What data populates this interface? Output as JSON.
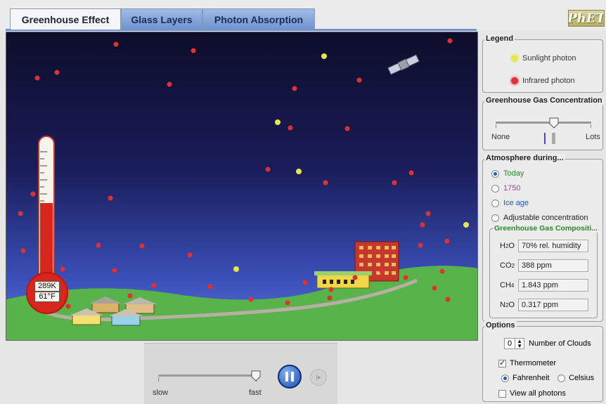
{
  "tabs": [
    {
      "label": "Greenhouse Effect",
      "active": true
    },
    {
      "label": "Glass Layers",
      "active": false
    },
    {
      "label": "Photon Absorption",
      "active": false
    }
  ],
  "logo": {
    "text": "PhET"
  },
  "thermometer": {
    "kelvin": "289K",
    "fahrenheit": "61°F"
  },
  "sim_controls": {
    "slow_label": "slow",
    "fast_label": "fast",
    "speed_fraction": 0.95,
    "pause_icon": "pause-icon",
    "step_icon": "step-icon"
  },
  "legend": {
    "title": "Legend",
    "sunlight_label": "Sunlight photon",
    "infrared_label": "Infrared photon",
    "sunlight_color": "#e6e84a",
    "infrared_color": "#e23030"
  },
  "concentration": {
    "title": "Greenhouse Gas Concentration",
    "none_label": "None",
    "lots_label": "Lots",
    "level_fraction": 0.7
  },
  "atmosphere": {
    "title": "Atmosphere during...",
    "options": [
      {
        "label": "Today",
        "selected": true,
        "color": "#2a8a2a"
      },
      {
        "label": "1750",
        "selected": false,
        "color": "#a040c0"
      },
      {
        "label": "Ice age",
        "selected": false,
        "color": "#1e5ac8"
      },
      {
        "label": "Adjustable concentration",
        "selected": false,
        "color": "#222222"
      }
    ]
  },
  "composition": {
    "title": "Greenhouse Gas Compositi...",
    "rows": [
      {
        "gas": "H",
        "sub": "2",
        "gas2": "O",
        "value": "70% rel. humidity"
      },
      {
        "gas": "CO",
        "sub": "2",
        "gas2": "",
        "value": "388 ppm"
      },
      {
        "gas": "CH",
        "sub": "4",
        "gas2": "",
        "value": "1.843 ppm"
      },
      {
        "gas": "N",
        "sub": "2",
        "gas2": "O",
        "value": "0.317 ppm"
      }
    ]
  },
  "options": {
    "title": "Options",
    "clouds_value": "0",
    "clouds_label": "Number of Clouds",
    "thermometer_label": "Thermometer",
    "thermometer_checked": true,
    "fahrenheit_label": "Fahrenheit",
    "fahrenheit_selected": true,
    "celsius_label": "Celsius",
    "celsius_selected": false,
    "view_all_label": "View all photons",
    "view_all_checked": false
  }
}
